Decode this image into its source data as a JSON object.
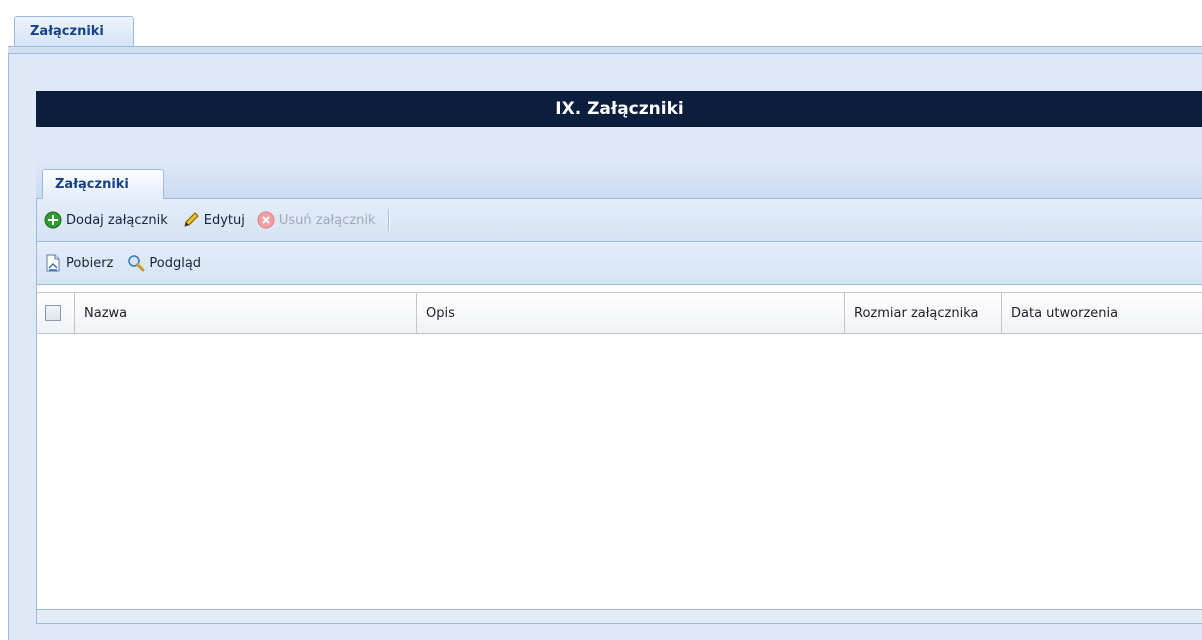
{
  "outer_tab": {
    "label": "Załączniki"
  },
  "section": {
    "title": "IX. Załączniki"
  },
  "inner_tab": {
    "label": "Załączniki"
  },
  "toolbar1": {
    "add_label": "Dodaj załącznik",
    "edit_label": "Edytuj",
    "delete_label": "Usuń załącznik"
  },
  "toolbar2": {
    "download_label": "Pobierz",
    "preview_label": "Podgląd"
  },
  "grid": {
    "columns": [
      "Nazwa",
      "Opis",
      "Rozmiar załącznika",
      "Data utworzenia"
    ],
    "rows": []
  },
  "colors": {
    "title_bar": "#0c1e3e",
    "panel_bg": "#dfe8f6",
    "border": "#99bbe8",
    "add_icon": "#2e9c2e",
    "delete_icon_disabled": "#f0a0a0"
  },
  "icons": {
    "add": "plus-circle-icon",
    "edit": "pencil-icon",
    "delete": "delete-circle-icon",
    "download": "download-document-icon",
    "preview": "magnifier-icon"
  }
}
